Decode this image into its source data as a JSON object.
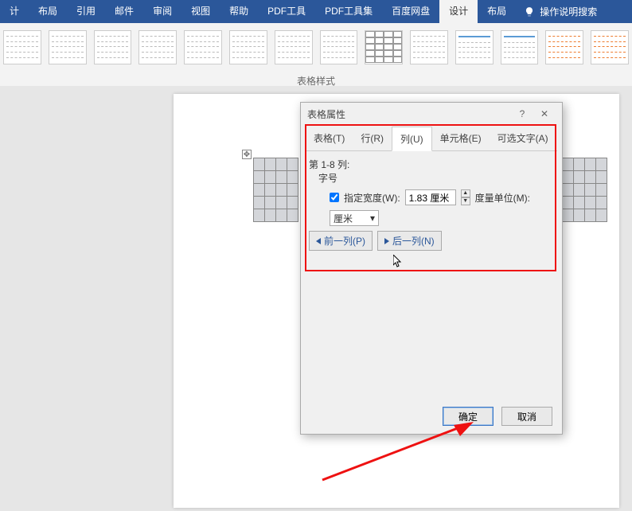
{
  "ribbon": {
    "tabs": [
      "计",
      "布局",
      "引用",
      "邮件",
      "审阅",
      "视图",
      "帮助",
      "PDF工具",
      "PDF工具集",
      "百度网盘",
      "设计",
      "布局"
    ],
    "active_index": 10,
    "tell_me": "操作说明搜索"
  },
  "panel": {
    "label": "表格样式"
  },
  "dialog": {
    "title": "表格属性",
    "help": "?",
    "close": "✕",
    "tabs": [
      "表格(T)",
      "行(R)",
      "列(U)",
      "单元格(E)",
      "可选文字(A)"
    ],
    "active_tab_index": 2,
    "col_range_label": "第 1-8 列:",
    "size_label": "字号",
    "specify_width_label": "指定宽度(W):",
    "specify_width_checked": true,
    "width_value": "1.83 厘米",
    "unit_label": "度量单位(M):",
    "unit_value": "厘米",
    "prev_col": "前一列(P)",
    "next_col": "后一列(N)",
    "ok": "确定",
    "cancel": "取消"
  }
}
